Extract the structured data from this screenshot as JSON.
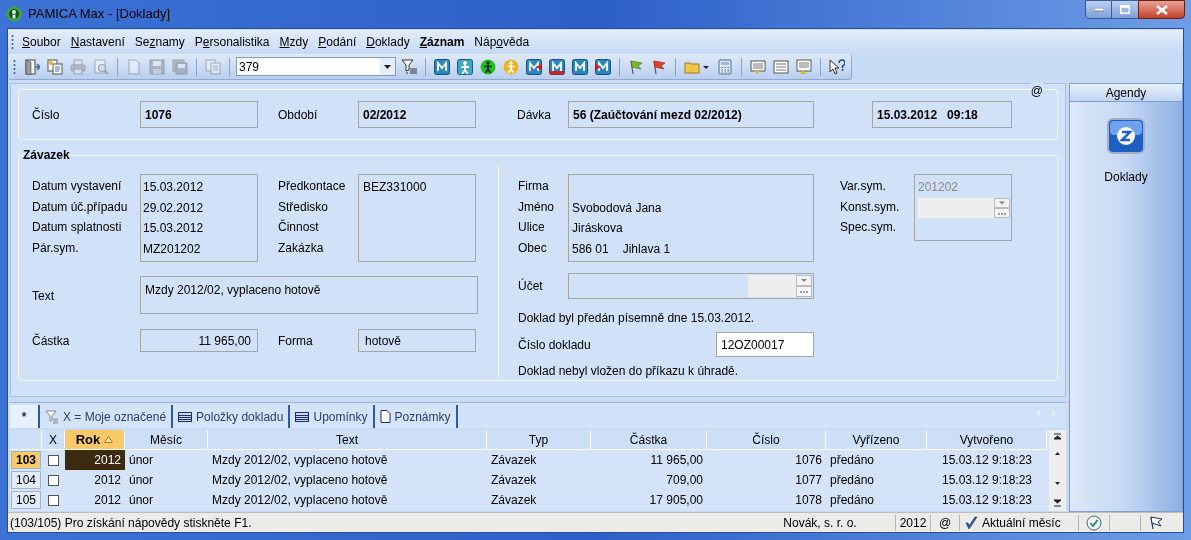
{
  "window": {
    "title": "PAMICA Max - [Doklady]"
  },
  "menu": [
    {
      "key": "S",
      "after": "oubor",
      "current": false
    },
    {
      "key": "N",
      "after": "astavení",
      "current": false
    },
    {
      "before": "Se",
      "key": "z",
      "after": "namy",
      "current": false
    },
    {
      "before": "P",
      "key": "e",
      "after": "rsonalistika",
      "current": false
    },
    {
      "key": "M",
      "after": "zdy",
      "current": false
    },
    {
      "key": "P",
      "after": "odání",
      "current": false
    },
    {
      "key": "D",
      "after": "oklady",
      "current": false
    },
    {
      "key": "Z",
      "after": "áznam",
      "current": true
    },
    {
      "before": "Náp",
      "key": "o",
      "after": "věda",
      "current": false
    }
  ],
  "toolbar": [
    {
      "kind": "exit",
      "disabled": false
    },
    {
      "kind": "documents",
      "disabled": false
    },
    {
      "kind": "print",
      "disabled": true
    },
    {
      "kind": "preview",
      "disabled": true
    },
    {
      "kind": "separator"
    },
    {
      "kind": "page",
      "disabled": true
    },
    {
      "kind": "save",
      "disabled": true
    },
    {
      "kind": "saveall",
      "disabled": true
    },
    {
      "kind": "separator"
    },
    {
      "kind": "copy",
      "disabled": true
    },
    {
      "kind": "separator"
    },
    {
      "kind": "combo",
      "value": "379"
    },
    {
      "kind": "filter",
      "disabled": false
    },
    {
      "kind": "separator"
    },
    {
      "kind": "tile",
      "disabled": false
    },
    {
      "kind": "person",
      "disabled": false
    },
    {
      "kind": "person_green",
      "disabled": false
    },
    {
      "kind": "person_yellow",
      "disabled": false
    },
    {
      "kind": "tile_arrow",
      "disabled": false
    },
    {
      "kind": "tile_red",
      "disabled": false
    },
    {
      "kind": "tile",
      "disabled": false
    },
    {
      "kind": "tile_arrow_red",
      "disabled": false
    },
    {
      "kind": "separator"
    },
    {
      "kind": "flag_green",
      "disabled": false
    },
    {
      "kind": "flag_red",
      "disabled": false
    },
    {
      "kind": "separator"
    },
    {
      "kind": "folder",
      "disabled": false
    },
    {
      "kind": "calculator",
      "disabled": false
    },
    {
      "kind": "separator"
    },
    {
      "kind": "list_down",
      "disabled": false
    },
    {
      "kind": "list",
      "disabled": false
    },
    {
      "kind": "list_up",
      "disabled": false
    },
    {
      "kind": "separator"
    },
    {
      "kind": "help",
      "disabled": false
    }
  ],
  "header": {
    "corner": "@",
    "fields": [
      {
        "label": "Číslo",
        "value": "1076"
      },
      {
        "label": "Období",
        "value": "02/2012"
      },
      {
        "label": "Dávka",
        "value": "56 (Zaúčtování mezd 02/2012)"
      }
    ],
    "date": "15.03.2012",
    "time": "09:18"
  },
  "zavazek": {
    "title": "Závazek",
    "dates": [
      {
        "label": "Datum vystavení",
        "value": "15.03.2012"
      },
      {
        "label": "Datum úč.případu",
        "value": "29.02.2012"
      },
      {
        "label": "Datum splatnosti",
        "value": "15.03.2012"
      },
      {
        "label": "Pár.sym.",
        "value": "MZ201202"
      }
    ],
    "accounting": [
      {
        "label": "Předkontace",
        "value": "BEZ331000"
      },
      {
        "label": "Středisko"
      },
      {
        "label": "Činnost"
      },
      {
        "label": "Zakázka"
      }
    ],
    "text": {
      "label": "Text",
      "value": "Mzdy 2012/02, vyplaceno hotově"
    },
    "amount": {
      "label": "Částka",
      "value": "11 965,00"
    },
    "form": {
      "label": "Forma",
      "value": "hotově"
    },
    "address": [
      {
        "label": "Firma"
      },
      {
        "label": "Jméno",
        "values": [
          "Svobodová Jana"
        ]
      },
      {
        "label": "Ulice",
        "values": [
          "Jiráskova"
        ]
      },
      {
        "label": "Obec",
        "values": [
          "586 01",
          "Jihlava 1"
        ]
      }
    ],
    "symbols": [
      {
        "label": "Var.sym.",
        "value": "201202",
        "disabled": true
      },
      {
        "label": "Konst.sym.",
        "kind": "combo"
      },
      {
        "label": "Spec.sym."
      }
    ],
    "account": {
      "label": "Účet"
    },
    "note_handed": "Doklad byl předán písemně dne 15.03.2012.",
    "doc_number": {
      "label": "Číslo dokladu",
      "value": "12OZ00017"
    },
    "note_payment": "Doklad nebyl vložen do příkazu k úhradě."
  },
  "tabs": [
    {
      "label": "*",
      "kind": "plain",
      "selected": true
    },
    {
      "label": "X = Moje označené",
      "kind": "filter",
      "selected": false
    },
    {
      "label": "Položky dokladu",
      "kind": "grid",
      "selected": false
    },
    {
      "label": "Upomínky",
      "kind": "grid",
      "selected": false
    },
    {
      "label": "Poznámky",
      "kind": "note",
      "selected": false
    }
  ],
  "table": {
    "check_column": "X",
    "columns": [
      {
        "label": "Rok",
        "sorted": true
      },
      {
        "label": "Měsíc",
        "sorted": false
      },
      {
        "label": "Text",
        "sorted": false
      },
      {
        "label": "Typ",
        "sorted": false
      },
      {
        "label": "Částka",
        "sorted": false
      },
      {
        "label": "Číslo",
        "sorted": false
      },
      {
        "label": "Vyřízeno",
        "sorted": false
      },
      {
        "label": "Vytvořeno",
        "sorted": false
      }
    ],
    "rows": [
      {
        "number": "103",
        "selected": true,
        "checked": false,
        "cells": [
          "2012",
          "únor",
          "Mzdy 2012/02, vyplaceno hotově",
          "Závazek",
          "11 965,00",
          "1076",
          "předáno",
          "15.03.12 9:18:23"
        ]
      },
      {
        "number": "104",
        "selected": false,
        "checked": false,
        "cells": [
          "2012",
          "únor",
          "Mzdy 2012/02, vyplaceno hotově",
          "Závazek",
          "709,00",
          "1077",
          "předáno",
          "15.03.12 9:18:23"
        ]
      },
      {
        "number": "105",
        "selected": false,
        "checked": false,
        "cells": [
          "2012",
          "únor",
          "Mzdy 2012/02, vyplaceno hotově",
          "Závazek",
          "17 905,00",
          "1078",
          "předáno",
          "15.03.12 9:18:23"
        ]
      }
    ]
  },
  "agendy": {
    "title": "Agendy",
    "items": [
      {
        "label": "Doklady"
      }
    ]
  },
  "status_bar": {
    "message": "(103/105) Pro získání nápovědy stiskněte F1.",
    "company": "Novák, s. r. o.",
    "year": "2012",
    "at": "@",
    "period": "Aktuální měsíc"
  }
}
